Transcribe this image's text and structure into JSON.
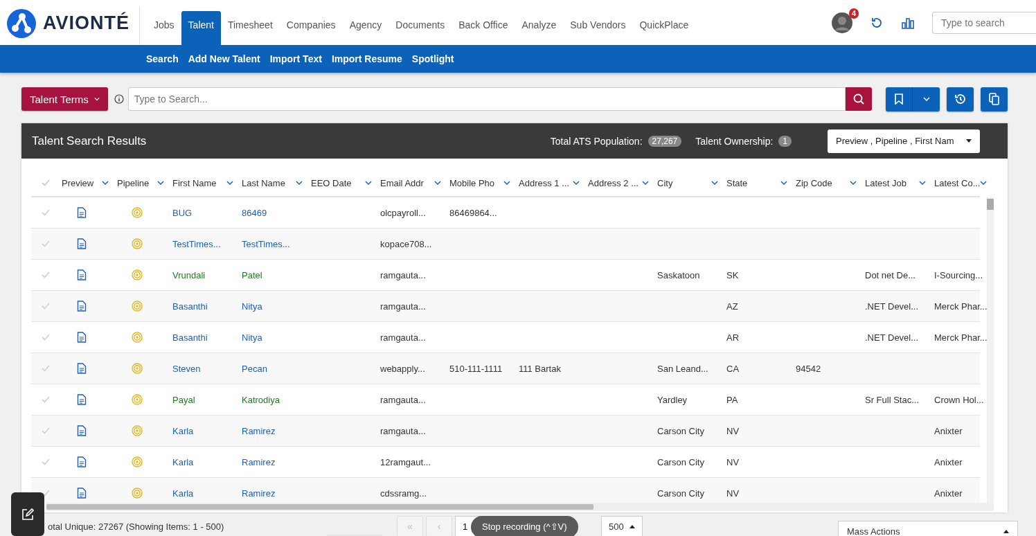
{
  "brand": {
    "name": "AVIONTÉ"
  },
  "nav": [
    {
      "label": "Jobs",
      "selected": false
    },
    {
      "label": "Talent",
      "selected": true
    },
    {
      "label": "Timesheet",
      "selected": false
    },
    {
      "label": "Companies",
      "selected": false
    },
    {
      "label": "Agency",
      "selected": false
    },
    {
      "label": "Documents",
      "selected": false
    },
    {
      "label": "Back Office",
      "selected": false
    },
    {
      "label": "Analyze",
      "selected": false
    },
    {
      "label": "Sub Vendors",
      "selected": false
    },
    {
      "label": "QuickPlace",
      "selected": false
    }
  ],
  "notifications": {
    "count": "4"
  },
  "global_search": {
    "placeholder": "Type to search"
  },
  "subnav": [
    "Search",
    "Add New Talent",
    "Import Text",
    "Import Resume",
    "Spotlight"
  ],
  "search_bar": {
    "terms_button": "Talent Terms",
    "placeholder": "Type to Search..."
  },
  "results": {
    "title": "Talent Search Results",
    "population_label": "Total ATS Population:",
    "population": "27,267",
    "ownership_label": "Talent Ownership:",
    "ownership": "1",
    "columns_select": "Preview , Pipeline , First Nam",
    "columns": [
      "Preview",
      "Pipeline",
      "First Name",
      "Last Name",
      "EEO Date",
      "Email Addr",
      "Mobile Pho",
      "Address 1 ...",
      "Address 2 ...",
      "City",
      "State",
      "Zip Code",
      "Latest Job",
      "Latest Co..."
    ],
    "rows": [
      {
        "selected": false,
        "color": "#1f5fb4",
        "first_name": "BUG",
        "last_name": "86469",
        "email": "olcpayroll...",
        "mobile_phone": "86469864..."
      },
      {
        "selected": false,
        "color": "#1f5fb4",
        "first_name": "TestTimes...",
        "last_name": "TestTimes...",
        "email": "kopace708..."
      },
      {
        "selected": false,
        "color": "#1e7a1e",
        "first_name": "Vrundali",
        "last_name": "Patel",
        "email": "ramgauta...",
        "city": "Saskatoon",
        "state": "SK",
        "latest_job": "Dot net De...",
        "latest_company": "I-Sourcing..."
      },
      {
        "selected": false,
        "color": "#1f5fb4",
        "first_name": "Basanthi",
        "last_name": "Nitya",
        "email": "ramgauta...",
        "state": "AZ",
        "latest_job": ".NET Devel...",
        "latest_company": "Merck Phar..."
      },
      {
        "selected": false,
        "color": "#1f5fb4",
        "first_name": "Basanthi",
        "last_name": "Nitya",
        "email": "ramgauta...",
        "state": "AR",
        "latest_job": ".NET Devel...",
        "latest_company": "Merck Phar..."
      },
      {
        "selected": false,
        "color": "#1f5fb4",
        "first_name": "Steven",
        "last_name": "Pecan",
        "email": "webapply...",
        "mobile_phone": "510-111-1111",
        "address_1": "111 Bartak",
        "city": "San Leand...",
        "state": "CA",
        "zip_code": "94542"
      },
      {
        "selected": false,
        "color": "#1e7a1e",
        "first_name": "Payal",
        "last_name": "Katrodiya",
        "email": "ramgauta...",
        "city": "Yardley",
        "state": "PA",
        "latest_job": "Sr Full Stac...",
        "latest_company": "Crown Hol..."
      },
      {
        "selected": false,
        "color": "#1f5fb4",
        "first_name": "Karla",
        "last_name": "Ramirez",
        "email": "ramgauta...",
        "city": "Carson City",
        "state": "NV",
        "latest_company": "Anixter"
      },
      {
        "selected": false,
        "color": "#1f5fb4",
        "first_name": "Karla",
        "last_name": "Ramirez",
        "email": "12ramgaut...",
        "city": "Carson City",
        "state": "NV",
        "latest_company": "Anixter"
      },
      {
        "selected": false,
        "color": "#1f5fb4",
        "first_name": "Karla",
        "last_name": "Ramirez",
        "email": "cdssramg...",
        "city": "Carson City",
        "state": "NV",
        "latest_company": "Anixter"
      }
    ]
  },
  "footer": {
    "summary": "otal Unique: 27267 (Showing Items: 1 - 500)",
    "first_page": "«",
    "prev_page": "‹",
    "page": "1",
    "page_size": "500",
    "mass_actions": "Mass Actions"
  },
  "recording": {
    "label": "Stop recording (^⇧V)"
  }
}
